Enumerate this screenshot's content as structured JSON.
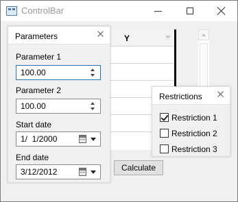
{
  "window": {
    "title": "ControlBar",
    "app_icon": "window-app-icon",
    "controls": [
      "minimize-icon",
      "maximize-icon",
      "close-icon"
    ]
  },
  "grid": {
    "column_header": "Y"
  },
  "parameters_panel": {
    "title": "Parameters",
    "parameter1": {
      "label": "Parameter 1",
      "value": "100.00"
    },
    "parameter2": {
      "label": "Parameter 2",
      "value": "100.00"
    },
    "start_date": {
      "label": "Start date",
      "value": "1/  1/2000"
    },
    "end_date": {
      "label": "End date",
      "value": "3/12/2012"
    }
  },
  "restrictions_panel": {
    "title": "Restrictions",
    "items": [
      {
        "label": "Restriction 1",
        "checked": true
      },
      {
        "label": "Restriction 2",
        "checked": false
      },
      {
        "label": "Restriction 3",
        "checked": false
      }
    ]
  },
  "actions": {
    "calculate_label": "Calculate"
  },
  "colors": {
    "focus_border": "#2a6fb3",
    "client_bg": "#f0f0f0"
  }
}
